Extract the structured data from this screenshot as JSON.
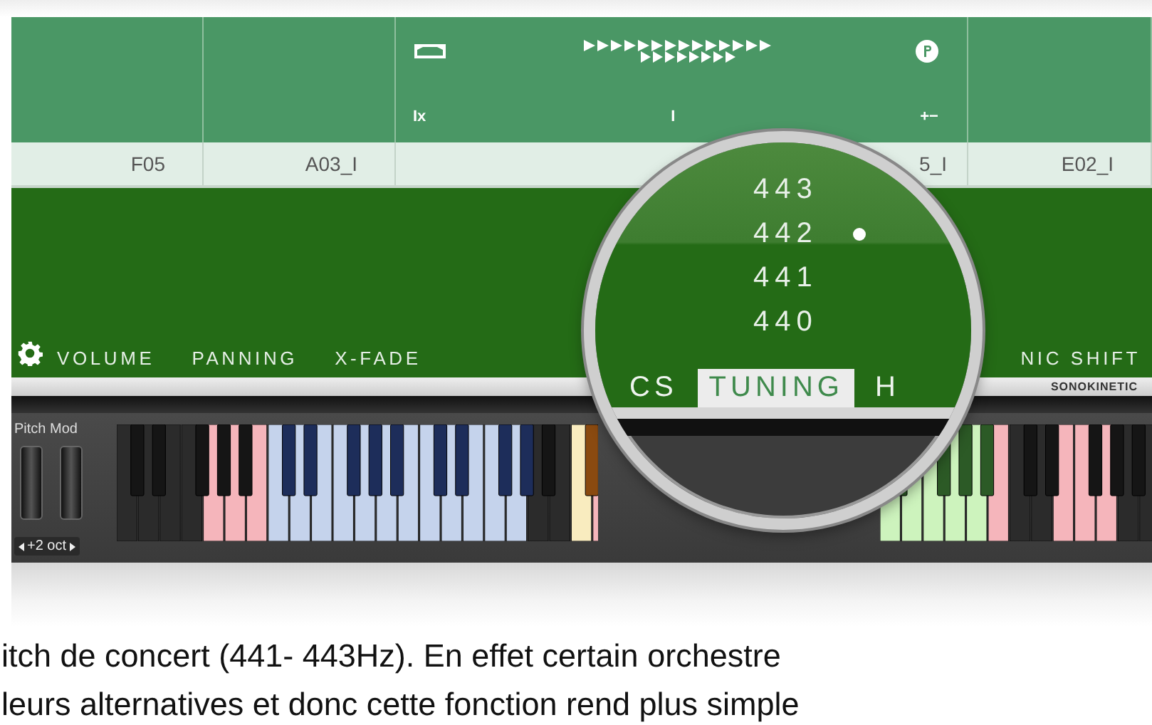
{
  "header": {
    "column_3": {
      "left_label": "Ix",
      "center_label": "I",
      "right_label": "+−"
    }
  },
  "cells": [
    "F05",
    "A03_I",
    "5_I",
    "E02_I"
  ],
  "params": [
    "VOLUME",
    "PANNING",
    "X-FADE"
  ],
  "right_param": "NIC SHIFT",
  "brand": "SONOKINETIC",
  "magnifier": {
    "options": [
      {
        "label": "443",
        "selected": false
      },
      {
        "label": "442",
        "selected": true
      },
      {
        "label": "441",
        "selected": false
      },
      {
        "label": "440",
        "selected": false
      }
    ],
    "tabs": [
      {
        "label": "CS",
        "selected": false
      },
      {
        "label": "TUNING",
        "selected": true
      },
      {
        "label": "H",
        "selected": false
      }
    ]
  },
  "pitch_mod": {
    "label": "Pitch Mod",
    "octave": "+2 oct"
  },
  "paragraph": [
    "itch de concert (441- 443Hz). En effet certain orchestre",
    "leurs alternatives et donc cette fonction rend plus simple"
  ]
}
